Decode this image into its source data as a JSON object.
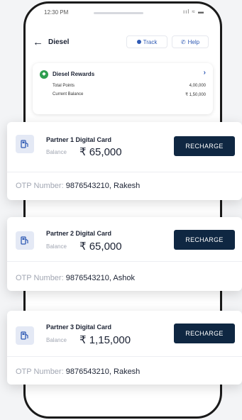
{
  "status_bar": {
    "time": "12:30 PM",
    "icons": "ııl ≈ ▬"
  },
  "header": {
    "title": "Diesel",
    "track_label": "Track",
    "help_label": "Help"
  },
  "rewards": {
    "title": "Diesel Rewards",
    "rows": [
      {
        "label": "Total Points",
        "value": "4,00,000"
      },
      {
        "label": "Current Balance",
        "value": "₹ 1,50,000"
      }
    ]
  },
  "cards": [
    {
      "name": "Partner 1 Digital Card",
      "balance_label": "Balance",
      "balance_value": "₹ 65,000",
      "recharge_label": "RECHARGE",
      "otp_label": "OTP Number:",
      "otp_value": "9876543210, Rakesh"
    },
    {
      "name": "Partner 2 Digital Card",
      "balance_label": "Balance",
      "balance_value": "₹ 65,000",
      "recharge_label": "RECHARGE",
      "otp_label": "OTP Number:",
      "otp_value": "9876543210, Ashok"
    },
    {
      "name": "Partner 3 Digital Card",
      "balance_label": "Balance",
      "balance_value": "₹ 1,15,000",
      "recharge_label": "RECHARGE",
      "otp_label": "OTP Number:",
      "otp_value": "9876543210, Rakesh"
    }
  ],
  "colors": {
    "primary_dark": "#0f2742",
    "link_blue": "#2f5ab4",
    "reward_green": "#2e9e4f",
    "muted_text": "#a2a7b3"
  },
  "icons": {
    "back": "arrow-left-icon",
    "track": "location-dot-icon",
    "help": "phone-icon",
    "rewards": "reward-badge-icon",
    "card": "fuel-pump-icon"
  }
}
